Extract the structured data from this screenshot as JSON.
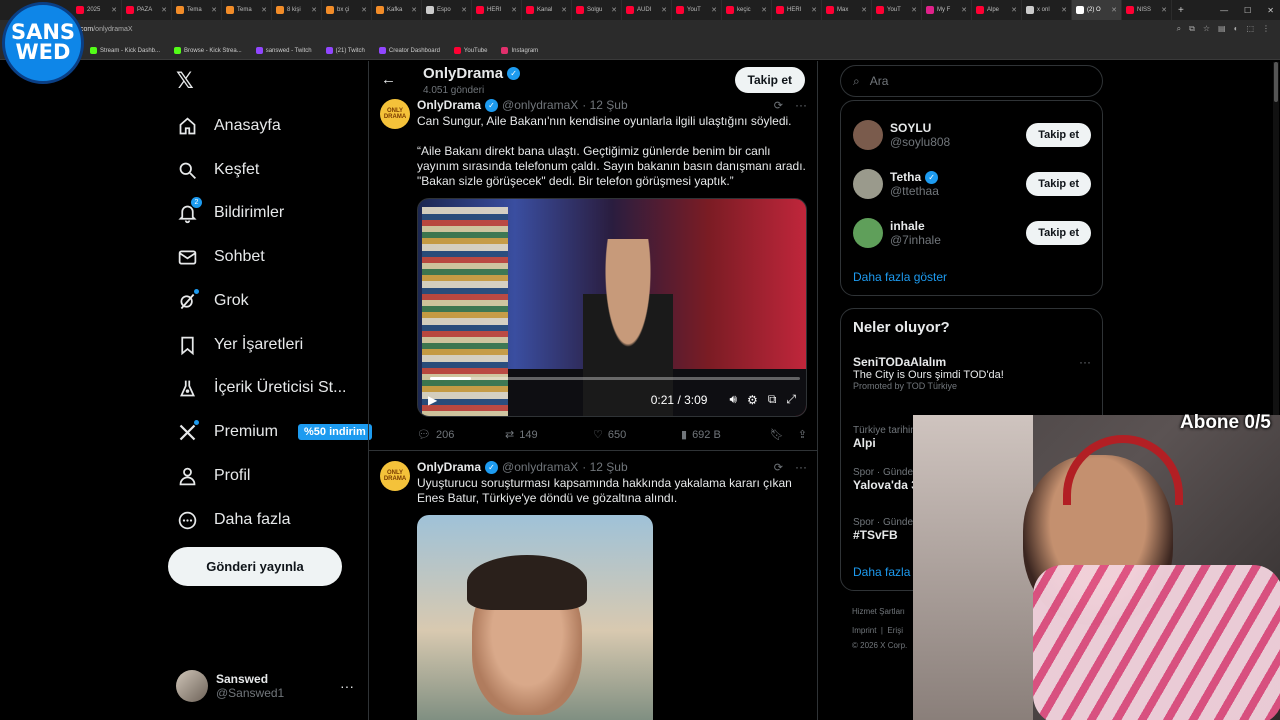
{
  "browser": {
    "tabs": [
      {
        "label": "2025",
        "color": "#ff0033"
      },
      {
        "label": "PAZA",
        "color": "#ff0033"
      },
      {
        "label": "Tema",
        "color": "#f28c28"
      },
      {
        "label": "Tema",
        "color": "#f28c28"
      },
      {
        "label": "8 kişi",
        "color": "#f28c28"
      },
      {
        "label": "bx çi",
        "color": "#f28c28"
      },
      {
        "label": "Kafka",
        "color": "#f28c28"
      },
      {
        "label": "Espo",
        "color": "#cccccc"
      },
      {
        "label": "HERI",
        "color": "#ff0033"
      },
      {
        "label": "Kanal",
        "color": "#ff0033"
      },
      {
        "label": "Solgu",
        "color": "#ff0033"
      },
      {
        "label": "AUDI",
        "color": "#ff0033"
      },
      {
        "label": "YouT",
        "color": "#ff0033"
      },
      {
        "label": "keçic",
        "color": "#ff0033"
      },
      {
        "label": "HERI",
        "color": "#ff0033"
      },
      {
        "label": "Max",
        "color": "#ff0033"
      },
      {
        "label": "YouT",
        "color": "#ff0033"
      },
      {
        "label": "My F",
        "color": "#e0218a"
      },
      {
        "label": "Alpe",
        "color": "#ff0033"
      },
      {
        "label": "x onl",
        "color": "#cccccc"
      },
      {
        "label": "(2) O",
        "color": "#ffffff"
      },
      {
        "label": "NISS",
        "color": "#ff0033"
      }
    ],
    "active_tab_index": 20,
    "url_domain": "com",
    "url_path": "/onlydramaX",
    "bookmarks": [
      {
        "label": "Stream - Kick Dashb...",
        "color": "#53fc18"
      },
      {
        "label": "Browse - Kick Strea...",
        "color": "#53fc18"
      },
      {
        "label": "sanswed - Twitch",
        "color": "#9146ff"
      },
      {
        "label": "(21) Twitch",
        "color": "#9146ff"
      },
      {
        "label": "Creator Dashboard",
        "color": "#9146ff"
      },
      {
        "label": "YouTube",
        "color": "#ff0033"
      },
      {
        "label": "Instagram",
        "color": "#e1306c"
      }
    ]
  },
  "overlay": {
    "logo_line1": "SANS",
    "logo_line2": "WED",
    "subscriber_goal": "Abone 0/5"
  },
  "nav": {
    "items": [
      {
        "label": "Anasayfa",
        "icon": "home-icon"
      },
      {
        "label": "Keşfet",
        "icon": "search-icon"
      },
      {
        "label": "Bildirimler",
        "icon": "bell-icon",
        "badge": "2"
      },
      {
        "label": "Sohbet",
        "icon": "mail-icon"
      },
      {
        "label": "Grok",
        "icon": "grok-icon"
      },
      {
        "label": "Yer İşaretleri",
        "icon": "bookmark-icon"
      },
      {
        "label": "İçerik Üreticisi St...",
        "icon": "flask-icon"
      },
      {
        "label": "Premium",
        "icon": "x-premium-icon",
        "promo": "%50 indirim"
      },
      {
        "label": "Profil",
        "icon": "person-icon"
      },
      {
        "label": "Daha fazla",
        "icon": "more-circle-icon"
      }
    ],
    "post_button": "Gönderi yayınla",
    "account": {
      "name": "Sanswed",
      "handle": "@Sanswed1"
    }
  },
  "profile_header": {
    "name": "OnlyDrama",
    "post_count": "4.051 gönderi",
    "follow_label": "Takip et"
  },
  "tweets": [
    {
      "name": "OnlyDrama",
      "handle": "@onlydramaX",
      "date": "· 12 Şub",
      "avatar_text": "ONLY DRAMA",
      "text": "Can Sungur, Aile Bakanı'nın kendisine oyunlarla ilgili ulaştığını söyledi.\n\n“Aile Bakanı direkt bana ulaştı. Geçtiğimiz günlerde benim bir canlı yayınım sırasında telefonum çaldı. Sayın bakanın basın danışmanı aradı. \"Bakan sizle görüşecek\" dedi. Bir telefon görüşmesi yaptık.”",
      "video": {
        "current": "0:21",
        "duration": "3:09",
        "progress": 0.11
      },
      "replies": "206",
      "reposts": "149",
      "likes": "650",
      "views": "692 B"
    },
    {
      "name": "OnlyDrama",
      "handle": "@onlydramaX",
      "date": "· 12 Şub",
      "avatar_text": "ONLY DRAMA",
      "text": "Uyuşturucu soruşturması kapsamında hakkında yakalama kararı çıkan Enes Batur, Türkiye'ye döndü ve gözaltına alındı."
    }
  ],
  "right": {
    "search_placeholder": "Ara",
    "who_to_follow": [
      {
        "name": "SOYLU",
        "handle": "@soylu808",
        "verified": false,
        "follow": "Takip et",
        "color": "#7a5b4c"
      },
      {
        "name": "Tetha",
        "handle": "@ttethaa",
        "verified": true,
        "follow": "Takip et",
        "color": "#9a9a8c"
      },
      {
        "name": "inhale",
        "handle": "@7inhale",
        "verified": false,
        "follow": "Takip et",
        "color": "#5f9f5a"
      }
    ],
    "show_more": "Daha fazla göster",
    "trends_title": "Neler oluyor?",
    "trends": [
      {
        "name": "SeniTODaAlalım",
        "desc": "The City is Ours şimdi TOD'da!",
        "promo": "Promoted by TOD Türkiye"
      },
      {
        "meta": "Türkiye tarihinde",
        "name": "Alpi"
      },
      {
        "meta": "Spor · Günde",
        "name": "Yalova'da 3"
      },
      {
        "meta": "Spor · Günde",
        "name": "#TSvFB"
      }
    ],
    "trends_more": "Daha fazla",
    "footer": [
      "Hizmet Şartları",
      "Imprint",
      "Erişi",
      "© 2026 X Corp."
    ]
  }
}
